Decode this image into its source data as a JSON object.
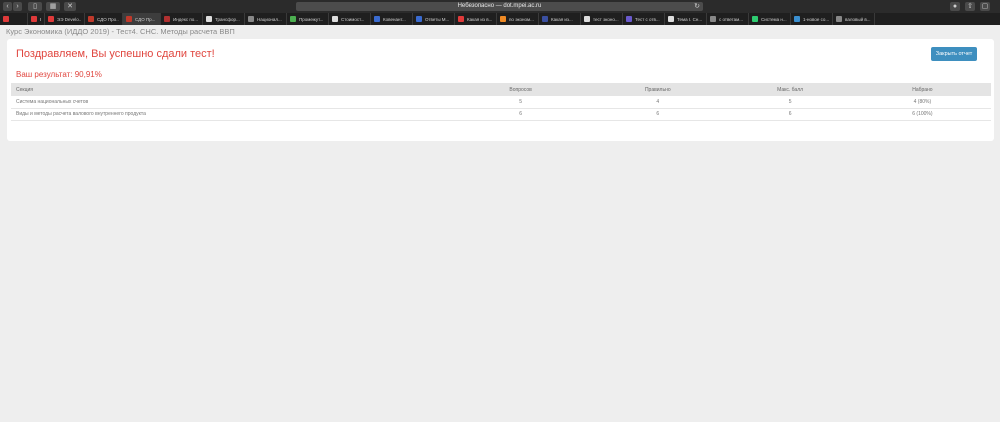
{
  "browser": {
    "address": "Небезопасно — dot.mpei.ac.ru",
    "tabs": [
      {
        "label": "",
        "color": "#e03a3a"
      },
      {
        "label": "ВЭ",
        "color": "#e03a3a"
      },
      {
        "label": "ЭЭ Develo...",
        "color": "#e03a3a"
      },
      {
        "label": "СДО Про...",
        "color": "#c0392b"
      },
      {
        "label": "СДО Пр...",
        "color": "#c0392b"
      },
      {
        "label": "Индекс по...",
        "color": "#b03030"
      },
      {
        "label": "Трансфор...",
        "color": "#dddddd"
      },
      {
        "label": "Национал...",
        "color": "#888888"
      },
      {
        "label": "Промежут...",
        "color": "#4caf50"
      },
      {
        "label": "Стоимост...",
        "color": "#dddddd"
      },
      {
        "label": "Ковенант...",
        "color": "#3a6bd0"
      },
      {
        "label": "Ответы М...",
        "color": "#3a6bd0"
      },
      {
        "label": "Какая из в...",
        "color": "#e03a3a"
      },
      {
        "label": "по эконом...",
        "color": "#f08a24"
      },
      {
        "label": "Какая из...",
        "color": "#3a4fa0"
      },
      {
        "label": "тест эконо...",
        "color": "#dddddd"
      },
      {
        "label": "Тест с отв...",
        "color": "#6a5acd"
      },
      {
        "label": "Тема I. Сн...",
        "color": "#dddddd"
      },
      {
        "label": "с ответам...",
        "color": "#888888"
      },
      {
        "label": "Система н...",
        "color": "#2ecc71"
      },
      {
        "label": "1-новое со...",
        "color": "#3a8fd0"
      },
      {
        "label": "валовый в...",
        "color": "#888888"
      }
    ]
  },
  "page": {
    "breadcrumb": "Курс Экономика (ИДДО 2019) - Тест4. СНС. Методы расчета ВВП",
    "congrats": "Поздравляем, Вы успешно сдали тест!",
    "result": "Ваш результат: 90,91%",
    "close_button": "Закрыть отчет"
  },
  "table": {
    "headers": [
      "Секция",
      "Вопросов",
      "Правильно",
      "Макс. балл",
      "Набрано"
    ],
    "rows": [
      [
        "Система национальных счетов",
        "5",
        "4",
        "5",
        "4 (80%)"
      ],
      [
        "Виды и методы расчета валового внутреннего продукта",
        "6",
        "6",
        "6",
        "6 (100%)"
      ]
    ]
  },
  "colors": {
    "accent_red": "#e0463f",
    "button_blue": "#3e8fbf"
  }
}
